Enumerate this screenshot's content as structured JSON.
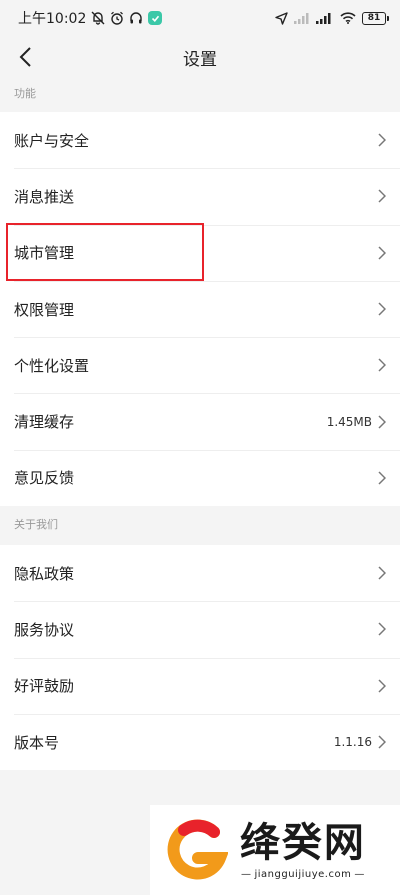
{
  "status_bar": {
    "time": "上午10:02",
    "battery": "81"
  },
  "nav": {
    "title": "设置"
  },
  "sections": [
    {
      "header": "功能",
      "items": [
        {
          "label": "账户与安全",
          "value": ""
        },
        {
          "label": "消息推送",
          "value": ""
        },
        {
          "label": "城市管理",
          "value": ""
        },
        {
          "label": "权限管理",
          "value": ""
        },
        {
          "label": "个性化设置",
          "value": ""
        },
        {
          "label": "清理缓存",
          "value": "1.45MB"
        },
        {
          "label": "意见反馈",
          "value": ""
        }
      ]
    },
    {
      "header": "关于我们",
      "items": [
        {
          "label": "隐私政策",
          "value": ""
        },
        {
          "label": "服务协议",
          "value": ""
        },
        {
          "label": "好评鼓励",
          "value": ""
        },
        {
          "label": "版本号",
          "value": "1.1.16"
        }
      ]
    }
  ],
  "watermark": {
    "name": "绛癸网",
    "url": "jiangguijiuye.com"
  },
  "colors": {
    "highlight": "#e8232b",
    "background": "#f4f4f4"
  }
}
